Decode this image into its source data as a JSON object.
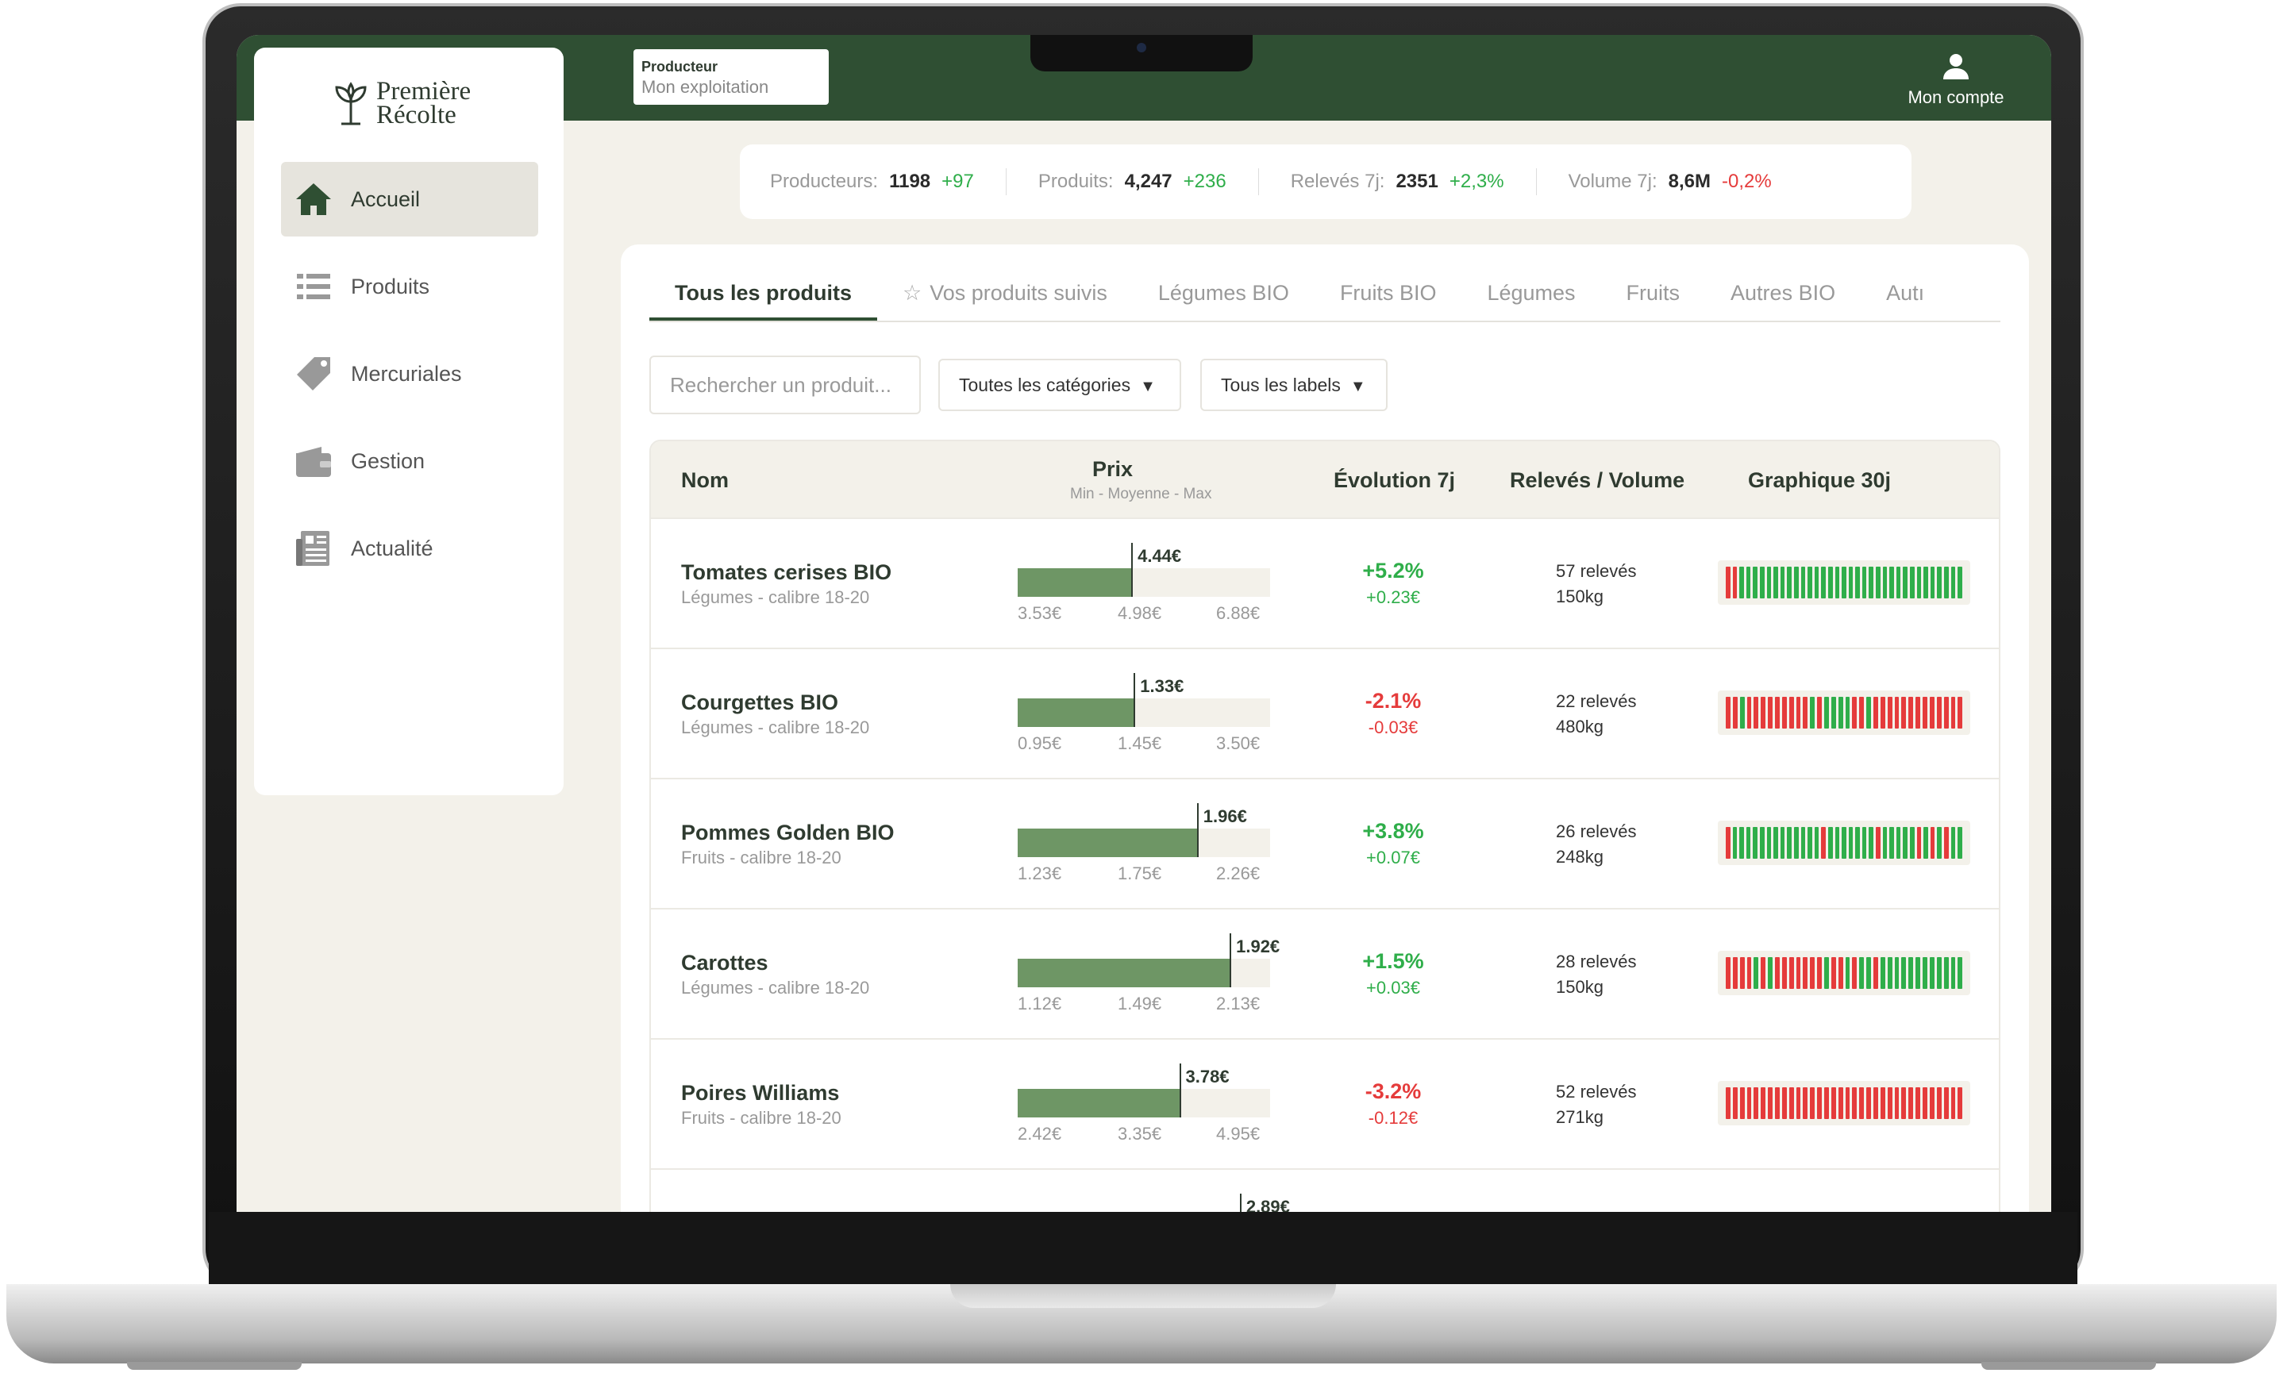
{
  "app": {
    "brand_line1": "Première",
    "brand_line2": "Récolte",
    "role_label": "Producteur",
    "farm_label": "Mon exploitation",
    "account_label": "Mon compte"
  },
  "sidebar": {
    "items": [
      {
        "label": "Accueil",
        "icon": "home-icon",
        "active": true
      },
      {
        "label": "Produits",
        "icon": "list-icon",
        "active": false
      },
      {
        "label": "Mercuriales",
        "icon": "tag-icon",
        "active": false
      },
      {
        "label": "Gestion",
        "icon": "wallet-icon",
        "active": false
      },
      {
        "label": "Actualité",
        "icon": "newspaper-icon",
        "active": false
      }
    ]
  },
  "stats": [
    {
      "label": "Producteurs:",
      "value": "1198",
      "delta": "+97",
      "trend": "up"
    },
    {
      "label": "Produits:",
      "value": "4,247",
      "delta": "+236",
      "trend": "up"
    },
    {
      "label": "Relevés 7j:",
      "value": "2351",
      "delta": "+2,3%",
      "trend": "up"
    },
    {
      "label": "Volume 7j:",
      "value": "8,6M",
      "delta": "-0,2%",
      "trend": "down"
    }
  ],
  "tabs": [
    "Tous les produits",
    "Vos produits suivis",
    "Légumes BIO",
    "Fruits BIO",
    "Légumes",
    "Fruits",
    "Autres BIO",
    "Autı"
  ],
  "filters": {
    "search_placeholder": "Rechercher un produit...",
    "category": "Toutes les catégories",
    "label": "Tous les labels"
  },
  "table": {
    "headers": {
      "name": "Nom",
      "price": "Prix",
      "price_sub": "Min - Moyenne - Max",
      "evolution": "Évolution 7j",
      "volume": "Relevés / Volume",
      "graph": "Graphique 30j"
    },
    "rows": [
      {
        "name": "Tomates cerises BIO",
        "sub": "Légumes - calibre 18-20",
        "current": "4.44€",
        "current_fraction": 0.45,
        "min": "3.53€",
        "avg": "4.98€",
        "max": "6.88€",
        "evo": "+5.2%",
        "evo_abs": "+0.23€",
        "trend": "up",
        "releves": "57 relevés",
        "volume": "150kg",
        "spark": "rrggggggggggggggggggggggggggggggggg"
      },
      {
        "name": "Courgettes BIO",
        "sub": "Légumes - calibre 18-20",
        "current": "1.33€",
        "current_fraction": 0.46,
        "min": "0.95€",
        "avg": "1.45€",
        "max": "3.50€",
        "evo": "-2.1%",
        "evo_abs": "-0.03€",
        "trend": "down",
        "releves": "22 relevés",
        "volume": "480kg",
        "spark": "rrgrrrrrrrrrgrggggrrgrrrrrrrrrrrrr"
      },
      {
        "name": "Pommes Golden BIO",
        "sub": "Fruits - calibre 18-20",
        "current": "1.96€",
        "current_fraction": 0.71,
        "min": "1.23€",
        "avg": "1.75€",
        "max": "2.26€",
        "evo": "+3.8%",
        "evo_abs": "+0.07€",
        "trend": "up",
        "releves": "26 relevés",
        "volume": "248kg",
        "spark": "rgggggggggggggrgggggggrgggggrgrgrgg"
      },
      {
        "name": "Carottes",
        "sub": "Légumes - calibre 18-20",
        "current": "1.92€",
        "current_fraction": 0.84,
        "min": "1.12€",
        "avg": "1.49€",
        "max": "2.13€",
        "evo": "+1.5%",
        "evo_abs": "+0.03€",
        "trend": "up",
        "releves": "28 relevés",
        "volume": "150kg",
        "spark": "rrrrgrgrrrrrrrgrrgrggrgggggggggggg"
      },
      {
        "name": "Poires Williams",
        "sub": "Fruits - calibre 18-20",
        "current": "3.78€",
        "current_fraction": 0.64,
        "min": "2.42€",
        "avg": "3.35€",
        "max": "4.95€",
        "evo": "-3.2%",
        "evo_abs": "-0.12€",
        "trend": "down",
        "releves": "52 relevés",
        "volume": "271kg",
        "spark": "rrrrrrrrrrrrrrrrrrrrrrrrrrrrrrrrrr"
      }
    ],
    "partial_row_current": "2.89€",
    "partial_row_current_fraction": 0.88
  },
  "colors": {
    "brand_green": "#2f4f33",
    "bar_green": "#6e9665",
    "positive": "#2fae4a",
    "negative": "#e53b3b",
    "background": "#f3f1ea"
  }
}
